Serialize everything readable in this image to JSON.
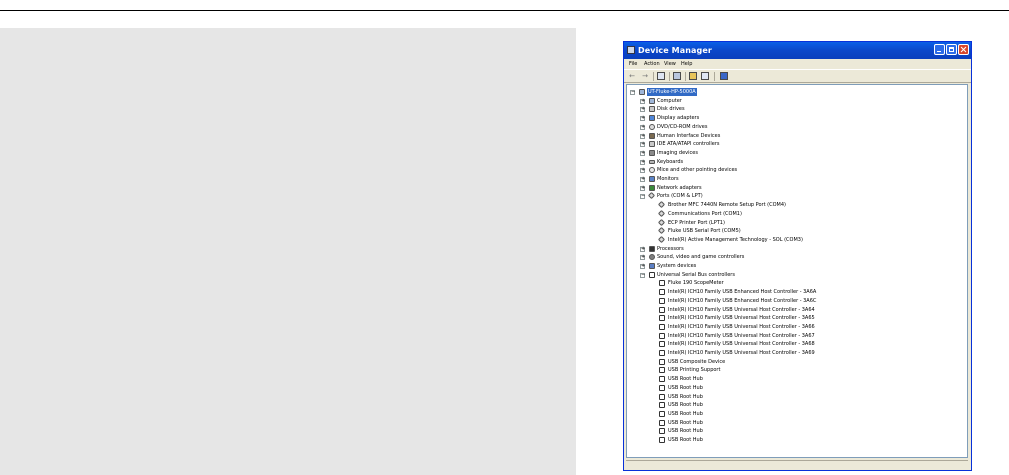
{
  "window": {
    "title": "Device Manager"
  },
  "menu": [
    "File",
    "Action",
    "View",
    "Help"
  ],
  "toolbar_icons": [
    "back-icon",
    "forward-icon",
    "properties-icon",
    "print-icon",
    "help-icon",
    "show-hide-icon",
    "scan-hardware-icon"
  ],
  "tree": {
    "root": "UT-Fluke-HP-5000A",
    "categories": [
      {
        "label": "Computer",
        "icon": "computer-icon",
        "expanded": false
      },
      {
        "label": "Disk drives",
        "icon": "disk-drive-icon",
        "expanded": false
      },
      {
        "label": "Display adapters",
        "icon": "display-adapter-icon",
        "expanded": false
      },
      {
        "label": "DVD/CD-ROM drives",
        "icon": "cdrom-icon",
        "expanded": false
      },
      {
        "label": "Human Interface Devices",
        "icon": "hid-icon",
        "expanded": false
      },
      {
        "label": "IDE ATA/ATAPI controllers",
        "icon": "ide-icon",
        "expanded": false
      },
      {
        "label": "Imaging devices",
        "icon": "imaging-icon",
        "expanded": false
      },
      {
        "label": "Keyboards",
        "icon": "keyboard-icon",
        "expanded": false
      },
      {
        "label": "Mice and other pointing devices",
        "icon": "mouse-icon",
        "expanded": false
      },
      {
        "label": "Monitors",
        "icon": "monitor-icon",
        "expanded": false
      },
      {
        "label": "Network adapters",
        "icon": "network-icon",
        "expanded": false
      },
      {
        "label": "Ports (COM & LPT)",
        "icon": "port-icon",
        "expanded": true,
        "children": [
          "Brother MFC 7440N Remote Setup Port (COM4)",
          "Communications Port (COM1)",
          "ECP Printer Port (LPT1)",
          "Fluke USB Serial Port (COM5)",
          "Intel(R) Active Management Technology - SOL (COM3)"
        ]
      },
      {
        "label": "Processors",
        "icon": "processor-icon",
        "expanded": false
      },
      {
        "label": "Sound, video and game controllers",
        "icon": "sound-icon",
        "expanded": false
      },
      {
        "label": "System devices",
        "icon": "system-icon",
        "expanded": false
      },
      {
        "label": "Universal Serial Bus controllers",
        "icon": "usb-icon",
        "expanded": true,
        "children": [
          "Fluke 190 ScopeMeter",
          "Intel(R) ICH10 Family USB Enhanced Host Controller - 3A6A",
          "Intel(R) ICH10 Family USB Enhanced Host Controller - 3A6C",
          "Intel(R) ICH10 Family USB Universal Host Controller - 3A64",
          "Intel(R) ICH10 Family USB Universal Host Controller - 3A65",
          "Intel(R) ICH10 Family USB Universal Host Controller - 3A66",
          "Intel(R) ICH10 Family USB Universal Host Controller - 3A67",
          "Intel(R) ICH10 Family USB Universal Host Controller - 3A68",
          "Intel(R) ICH10 Family USB Universal Host Controller - 3A69",
          "USB Composite Device",
          "USB Printing Support",
          "USB Root Hub",
          "USB Root Hub",
          "USB Root Hub",
          "USB Root Hub",
          "USB Root Hub",
          "USB Root Hub",
          "USB Root Hub",
          "USB Root Hub"
        ]
      }
    ]
  },
  "colors": {
    "titlebar": "#0b47c9",
    "window_bg": "#ece9d8",
    "selection": "#316ac5",
    "page_panel": "#e6e6e6"
  }
}
